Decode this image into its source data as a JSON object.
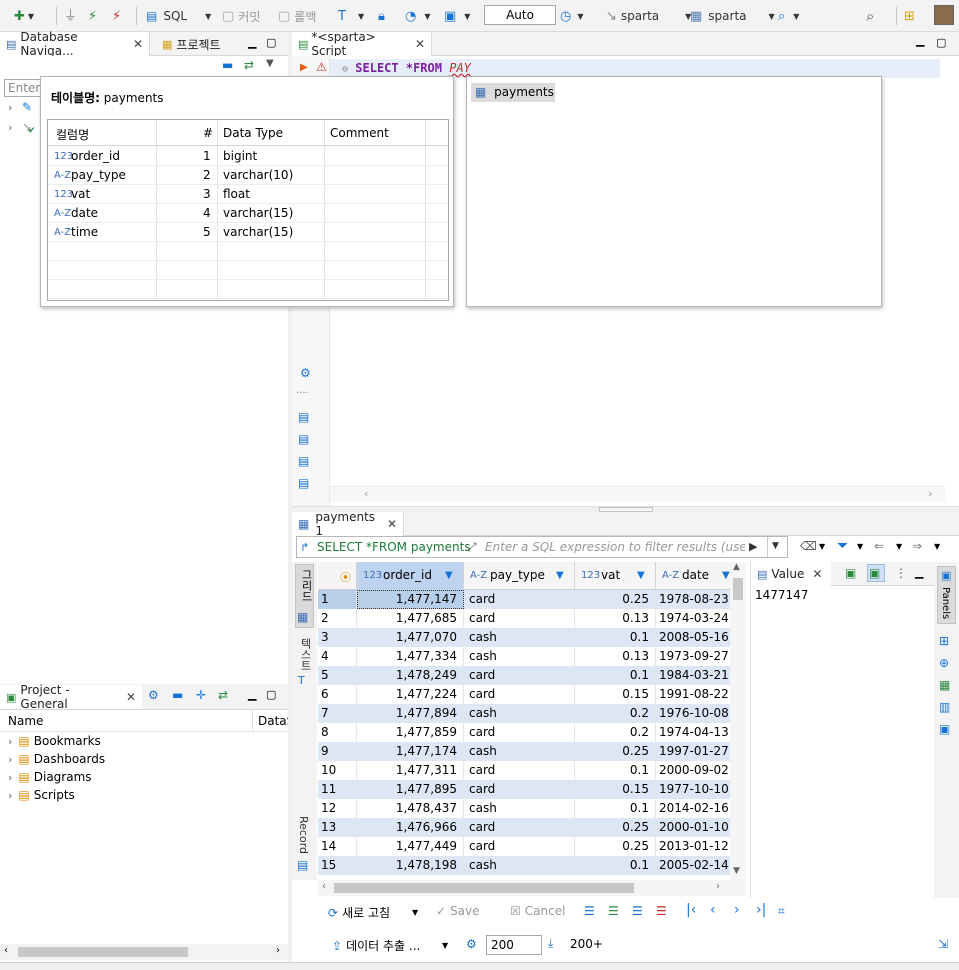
{
  "toolbar": {
    "sql_label": "SQL",
    "commit_label": "커밋",
    "rollback_label": "롤백",
    "auto_label": "Auto",
    "datasource": "sparta",
    "schema": "sparta"
  },
  "left": {
    "nav_tab": "Database Naviga...",
    "projects_tab": "프로젝트",
    "filter_placeholder": "Enter a",
    "project_panel_title": "Project - General",
    "project_col_name": "Name",
    "project_col_datasource": "DataS",
    "project_items": [
      "Bookmarks",
      "Dashboards",
      "Diagrams",
      "Scripts"
    ]
  },
  "editor": {
    "tab_title": "*<sparta> Script",
    "sql_keyword_select": "SELECT",
    "sql_keyword_from": "*FROM",
    "sql_typed": "PAY",
    "autocomplete_item": "payments"
  },
  "tooltip": {
    "title_label": "테이블명:",
    "title_value": "payments",
    "headers": [
      "컬럼명",
      "#",
      "Data Type",
      "Comment"
    ],
    "columns": [
      {
        "type_icon": "123",
        "name": "order_id",
        "num": "1",
        "dtype": "bigint"
      },
      {
        "type_icon": "A-Z",
        "name": "pay_type",
        "num": "2",
        "dtype": "varchar(10)"
      },
      {
        "type_icon": "123",
        "name": "vat",
        "num": "3",
        "dtype": "float"
      },
      {
        "type_icon": "A-Z",
        "name": "date",
        "num": "4",
        "dtype": "varchar(15)"
      },
      {
        "type_icon": "A-Z",
        "name": "time",
        "num": "5",
        "dtype": "varchar(15)"
      }
    ]
  },
  "results": {
    "tab_title": "payments 1",
    "query_text": "SELECT *FROM payments",
    "filter_placeholder": "Enter a SQL expression to filter results (use Ctrl+",
    "side_grid_label": "그리드",
    "side_text_label": "텍스트",
    "side_record_label": "Record",
    "headers": [
      {
        "type_icon": "123",
        "name": "order_id"
      },
      {
        "type_icon": "A-Z",
        "name": "pay_type"
      },
      {
        "type_icon": "123",
        "name": "vat"
      },
      {
        "type_icon": "A-Z",
        "name": "date"
      }
    ],
    "rows": [
      {
        "n": "1",
        "order_id": "1,477,147",
        "pay_type": "card",
        "vat": "0.25",
        "date": "1978-08-23"
      },
      {
        "n": "2",
        "order_id": "1,477,685",
        "pay_type": "card",
        "vat": "0.13",
        "date": "1974-03-24"
      },
      {
        "n": "3",
        "order_id": "1,477,070",
        "pay_type": "cash",
        "vat": "0.1",
        "date": "2008-05-16"
      },
      {
        "n": "4",
        "order_id": "1,477,334",
        "pay_type": "cash",
        "vat": "0.13",
        "date": "1973-09-27"
      },
      {
        "n": "5",
        "order_id": "1,478,249",
        "pay_type": "card",
        "vat": "0.1",
        "date": "1984-03-21"
      },
      {
        "n": "6",
        "order_id": "1,477,224",
        "pay_type": "card",
        "vat": "0.15",
        "date": "1991-08-22"
      },
      {
        "n": "7",
        "order_id": "1,477,894",
        "pay_type": "cash",
        "vat": "0.2",
        "date": "1976-10-08"
      },
      {
        "n": "8",
        "order_id": "1,477,859",
        "pay_type": "card",
        "vat": "0.2",
        "date": "1974-04-13"
      },
      {
        "n": "9",
        "order_id": "1,477,174",
        "pay_type": "cash",
        "vat": "0.25",
        "date": "1997-01-27"
      },
      {
        "n": "10",
        "order_id": "1,477,311",
        "pay_type": "card",
        "vat": "0.1",
        "date": "2000-09-02"
      },
      {
        "n": "11",
        "order_id": "1,477,895",
        "pay_type": "card",
        "vat": "0.15",
        "date": "1977-10-10"
      },
      {
        "n": "12",
        "order_id": "1,478,437",
        "pay_type": "cash",
        "vat": "0.1",
        "date": "2014-02-16"
      },
      {
        "n": "13",
        "order_id": "1,476,966",
        "pay_type": "card",
        "vat": "0.25",
        "date": "2000-01-10"
      },
      {
        "n": "14",
        "order_id": "1,477,449",
        "pay_type": "card",
        "vat": "0.25",
        "date": "2013-01-12"
      },
      {
        "n": "15",
        "order_id": "1,478,198",
        "pay_type": "cash",
        "vat": "0.1",
        "date": "2005-02-14"
      }
    ],
    "value_panel_title": "Value",
    "value_panel_content": "1477147",
    "panels_label": "Panels",
    "refresh_label": "새로 고침",
    "save_label": "Save",
    "cancel_label": "Cancel",
    "export_label": "데이터 추출 ...",
    "fetch_size": "200",
    "fetch_more": "200+"
  },
  "colors": {
    "row_even": "#dce6f4",
    "row_selected": "#b8cfe9",
    "accent": "#1673d6"
  }
}
